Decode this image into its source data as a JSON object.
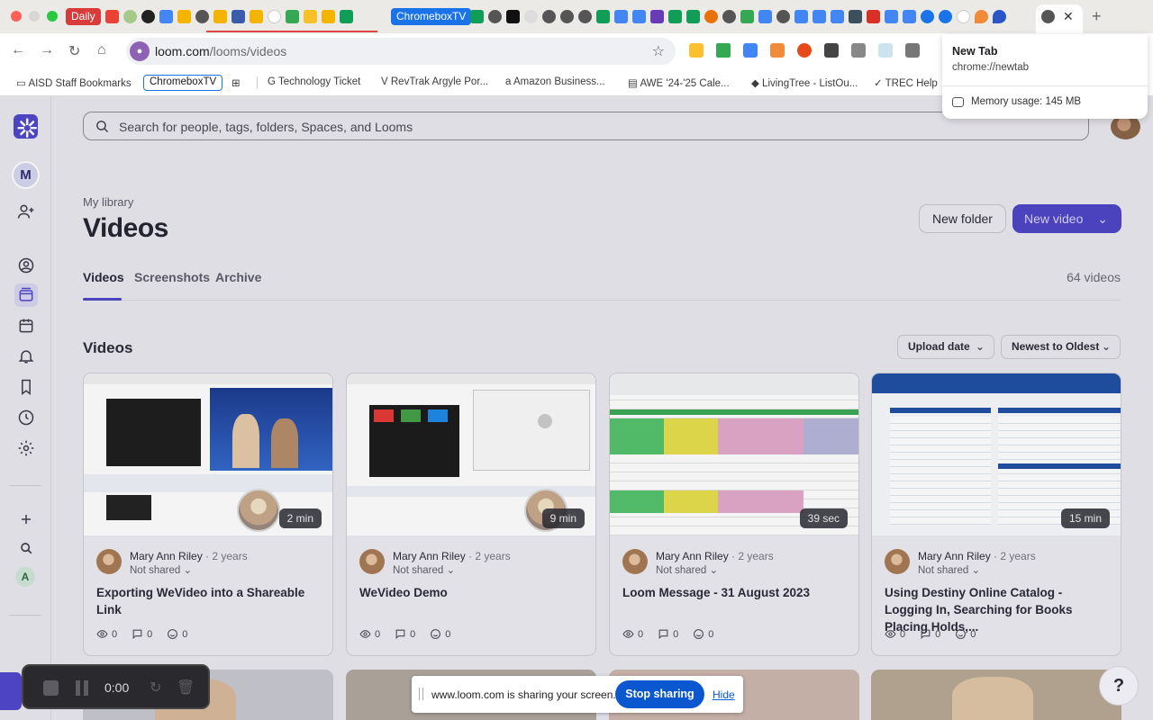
{
  "browser": {
    "tabs": {
      "daily_label": "Daily",
      "chromebox_label": "ChromeboxTV",
      "close_glyph": "✕",
      "new_tab_glyph": "+"
    },
    "address": {
      "url_host": "loom.com",
      "url_path": "/looms/videos"
    },
    "bookmarks": [
      {
        "label": "AISD Staff Bookmarks"
      },
      {
        "label": "ChromeboxTV"
      },
      {
        "label": "Technology Ticket"
      },
      {
        "label": "RevTrak Argyle Por..."
      },
      {
        "label": "Amazon Business..."
      },
      {
        "label": "AWE '24-'25 Cale..."
      },
      {
        "label": "LivingTree - ListOu..."
      },
      {
        "label": "TREC Help"
      }
    ],
    "tab_hover_card": {
      "title": "New Tab",
      "url": "chrome://newtab",
      "memory": "Memory usage: 145 MB"
    }
  },
  "app": {
    "workspace_initial": "M",
    "member_initial": "A",
    "search": {
      "placeholder": "Search for people, tags, folders, Spaces, and Looms"
    },
    "library": {
      "label": "My library",
      "title": "Videos"
    },
    "buttons": {
      "new_folder": "New folder",
      "new_video": "New video"
    },
    "tabs": [
      {
        "label": "Videos"
      },
      {
        "label": "Screenshots"
      },
      {
        "label": "Archive"
      }
    ],
    "video_count": "64 videos",
    "section_title": "Videos",
    "sort": {
      "field": "Upload date",
      "order": "Newest to Oldest"
    },
    "videos": [
      {
        "duration": "2 min",
        "owner": "Mary Ann Riley",
        "age": "· 2 years",
        "shared": "Not shared",
        "title": "Exporting WeVideo into a Shareable Link",
        "views": "0",
        "comments": "0",
        "reactions": "0"
      },
      {
        "duration": "9 min",
        "owner": "Mary Ann Riley",
        "age": "· 2 years",
        "shared": "Not shared",
        "title": "WeVideo Demo",
        "views": "0",
        "comments": "0",
        "reactions": "0"
      },
      {
        "duration": "39 sec",
        "owner": "Mary Ann Riley",
        "age": "· 2 years",
        "shared": "Not shared",
        "title": "Loom Message - 31 August 2023",
        "views": "0",
        "comments": "0",
        "reactions": "0"
      },
      {
        "duration": "15 min",
        "owner": "Mary Ann Riley",
        "age": "· 2 years",
        "shared": "Not shared",
        "title": "Using Destiny Online Catalog - Logging In, Searching for Books Placing Holds,...",
        "views": "0",
        "comments": "0",
        "reactions": "0"
      }
    ]
  },
  "recorder": {
    "time": "0:00"
  },
  "share_notice": {
    "text": "www.loom.com is sharing your screen.",
    "stop": "Stop sharing",
    "hide": "Hide"
  },
  "help": {
    "label": "?"
  }
}
